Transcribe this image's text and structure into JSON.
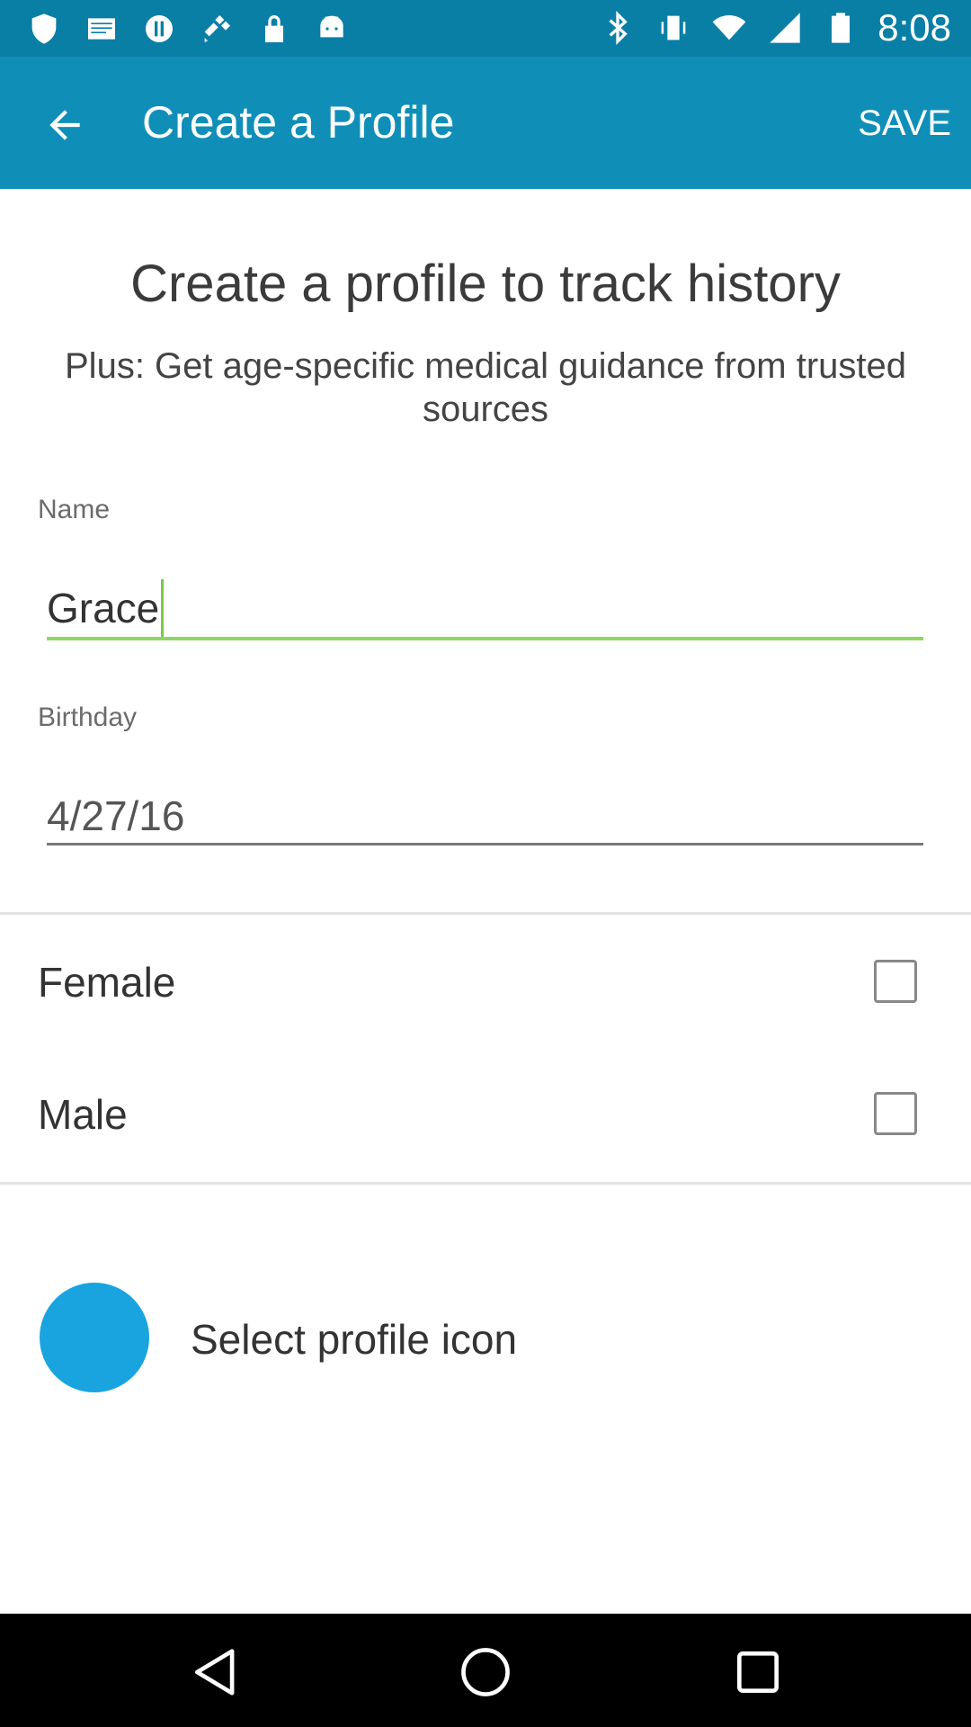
{
  "status_bar": {
    "time": "8:08",
    "left_icons": [
      "shield-icon",
      "mail-icon",
      "data-saver-icon",
      "satellite-icon",
      "lock-icon",
      "android-icon"
    ],
    "right_icons": [
      "bluetooth-icon",
      "vibrate-icon",
      "wifi-icon",
      "signal-icon",
      "battery-icon"
    ]
  },
  "app_bar": {
    "title": "Create a Profile",
    "save_label": "SAVE",
    "back_icon": "arrow-back-icon",
    "color": "#0f8fb8"
  },
  "main": {
    "heading": "Create a profile to track history",
    "subheading": "Plus: Get age-specific medical guidance from trusted sources",
    "name_label": "Name",
    "name_value": "Grace",
    "birthday_label": "Birthday",
    "birthday_value": "4/27/16",
    "gender_options": [
      {
        "label": "Female",
        "checked": false
      },
      {
        "label": "Male",
        "checked": false
      }
    ],
    "profile_icon_label": "Select profile icon",
    "profile_icon_color": "#19a4e0",
    "focus_color": "#8fd660"
  },
  "nav_bar": {
    "icons": [
      "back-triangle-icon",
      "home-circle-icon",
      "recents-square-icon"
    ]
  }
}
